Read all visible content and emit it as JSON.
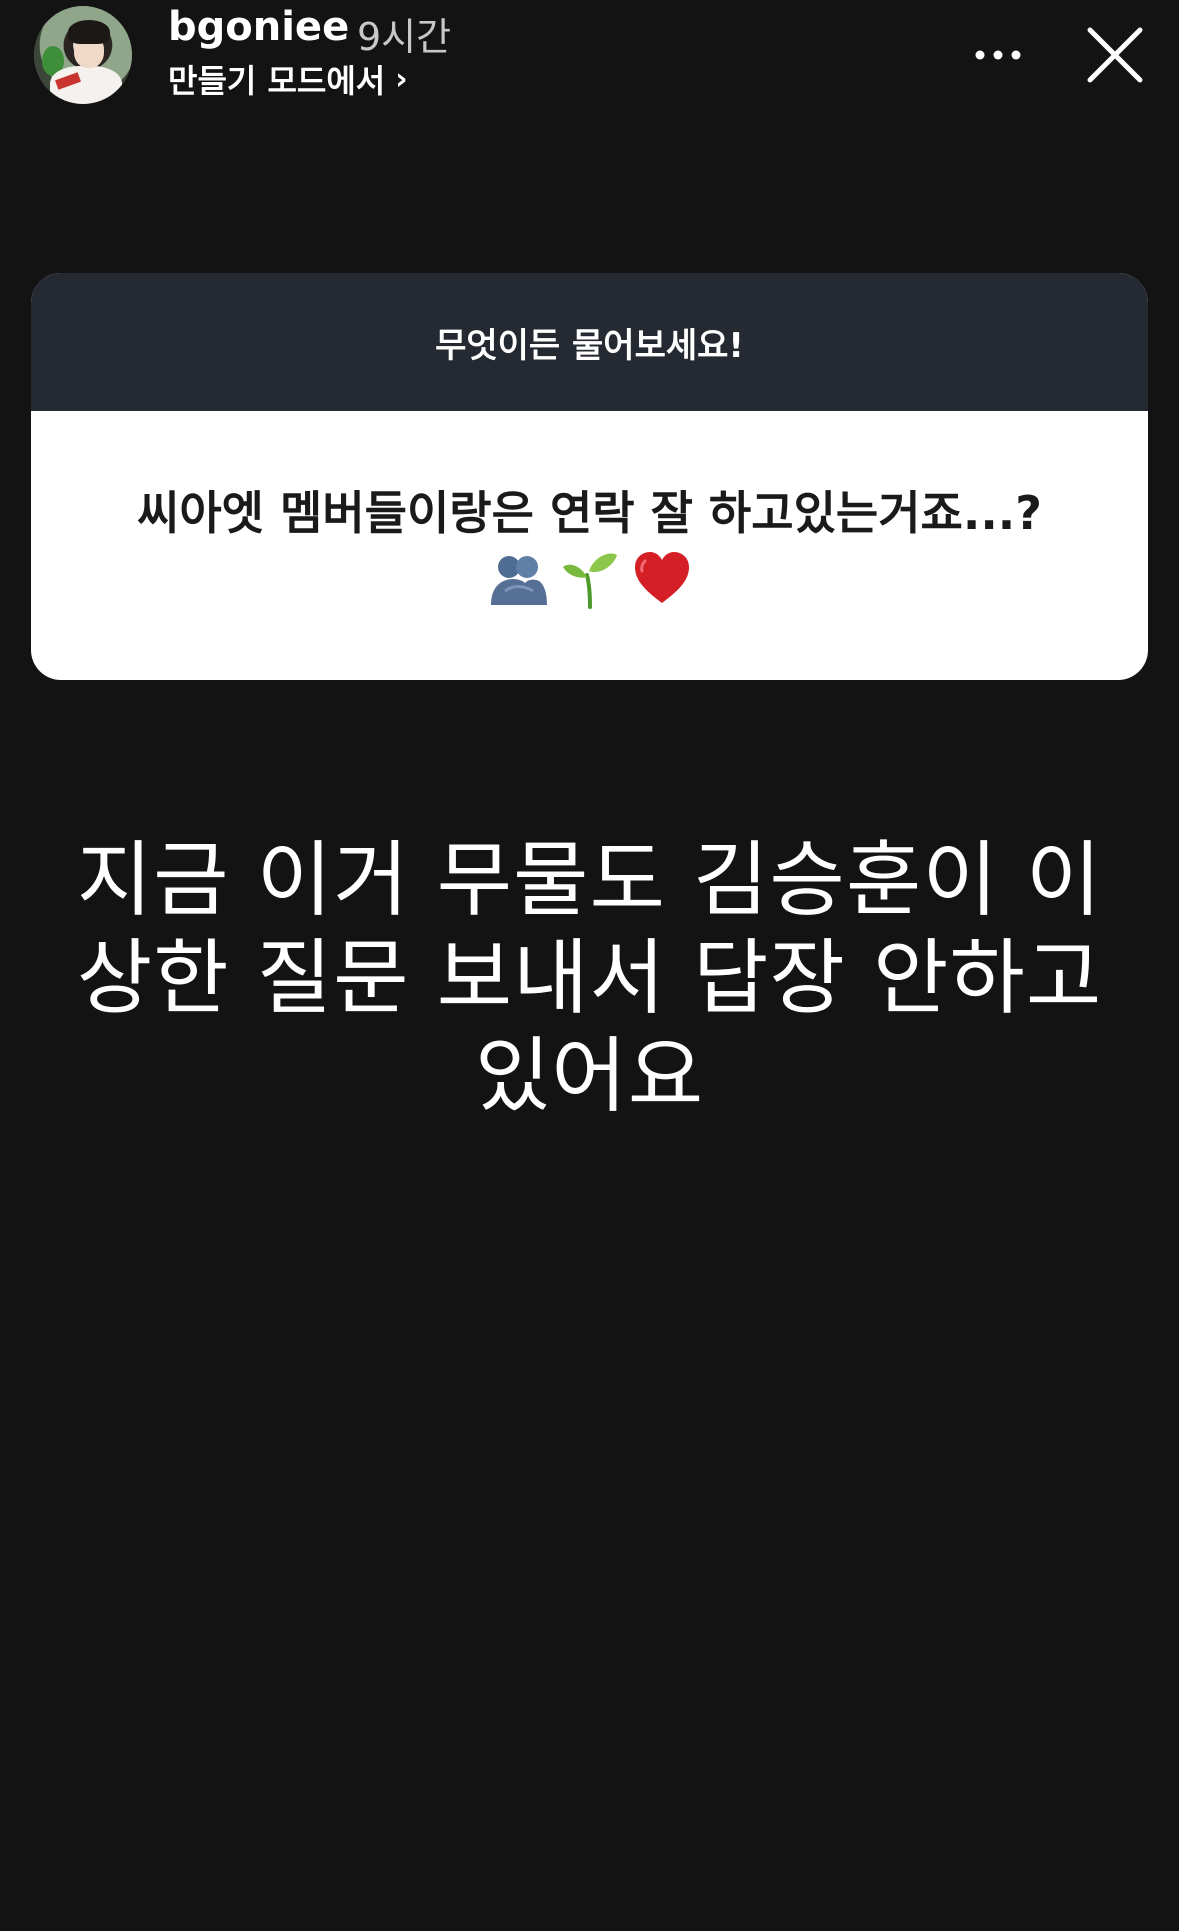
{
  "header": {
    "username": "bgoniee",
    "time_ago": "9시간",
    "mode_label": "만들기 모드에서",
    "mode_chevron": "›",
    "more_label": "•••"
  },
  "question_sticker": {
    "prompt": "무엇이든 물어보세요!",
    "question_text": "씨아엣 멤버들이랑은 연락 잘 하고있는거죠...?",
    "emojis": [
      "people-hugging-icon",
      "seedling-icon",
      "red-heart-icon"
    ]
  },
  "answer": {
    "text": "지금 이거 무물도 김승훈이 이상한 질문 보내서 답장 안하고 있어요"
  },
  "colors": {
    "background": "#131314",
    "card_header": "#252932",
    "card_body": "#ffffff"
  }
}
